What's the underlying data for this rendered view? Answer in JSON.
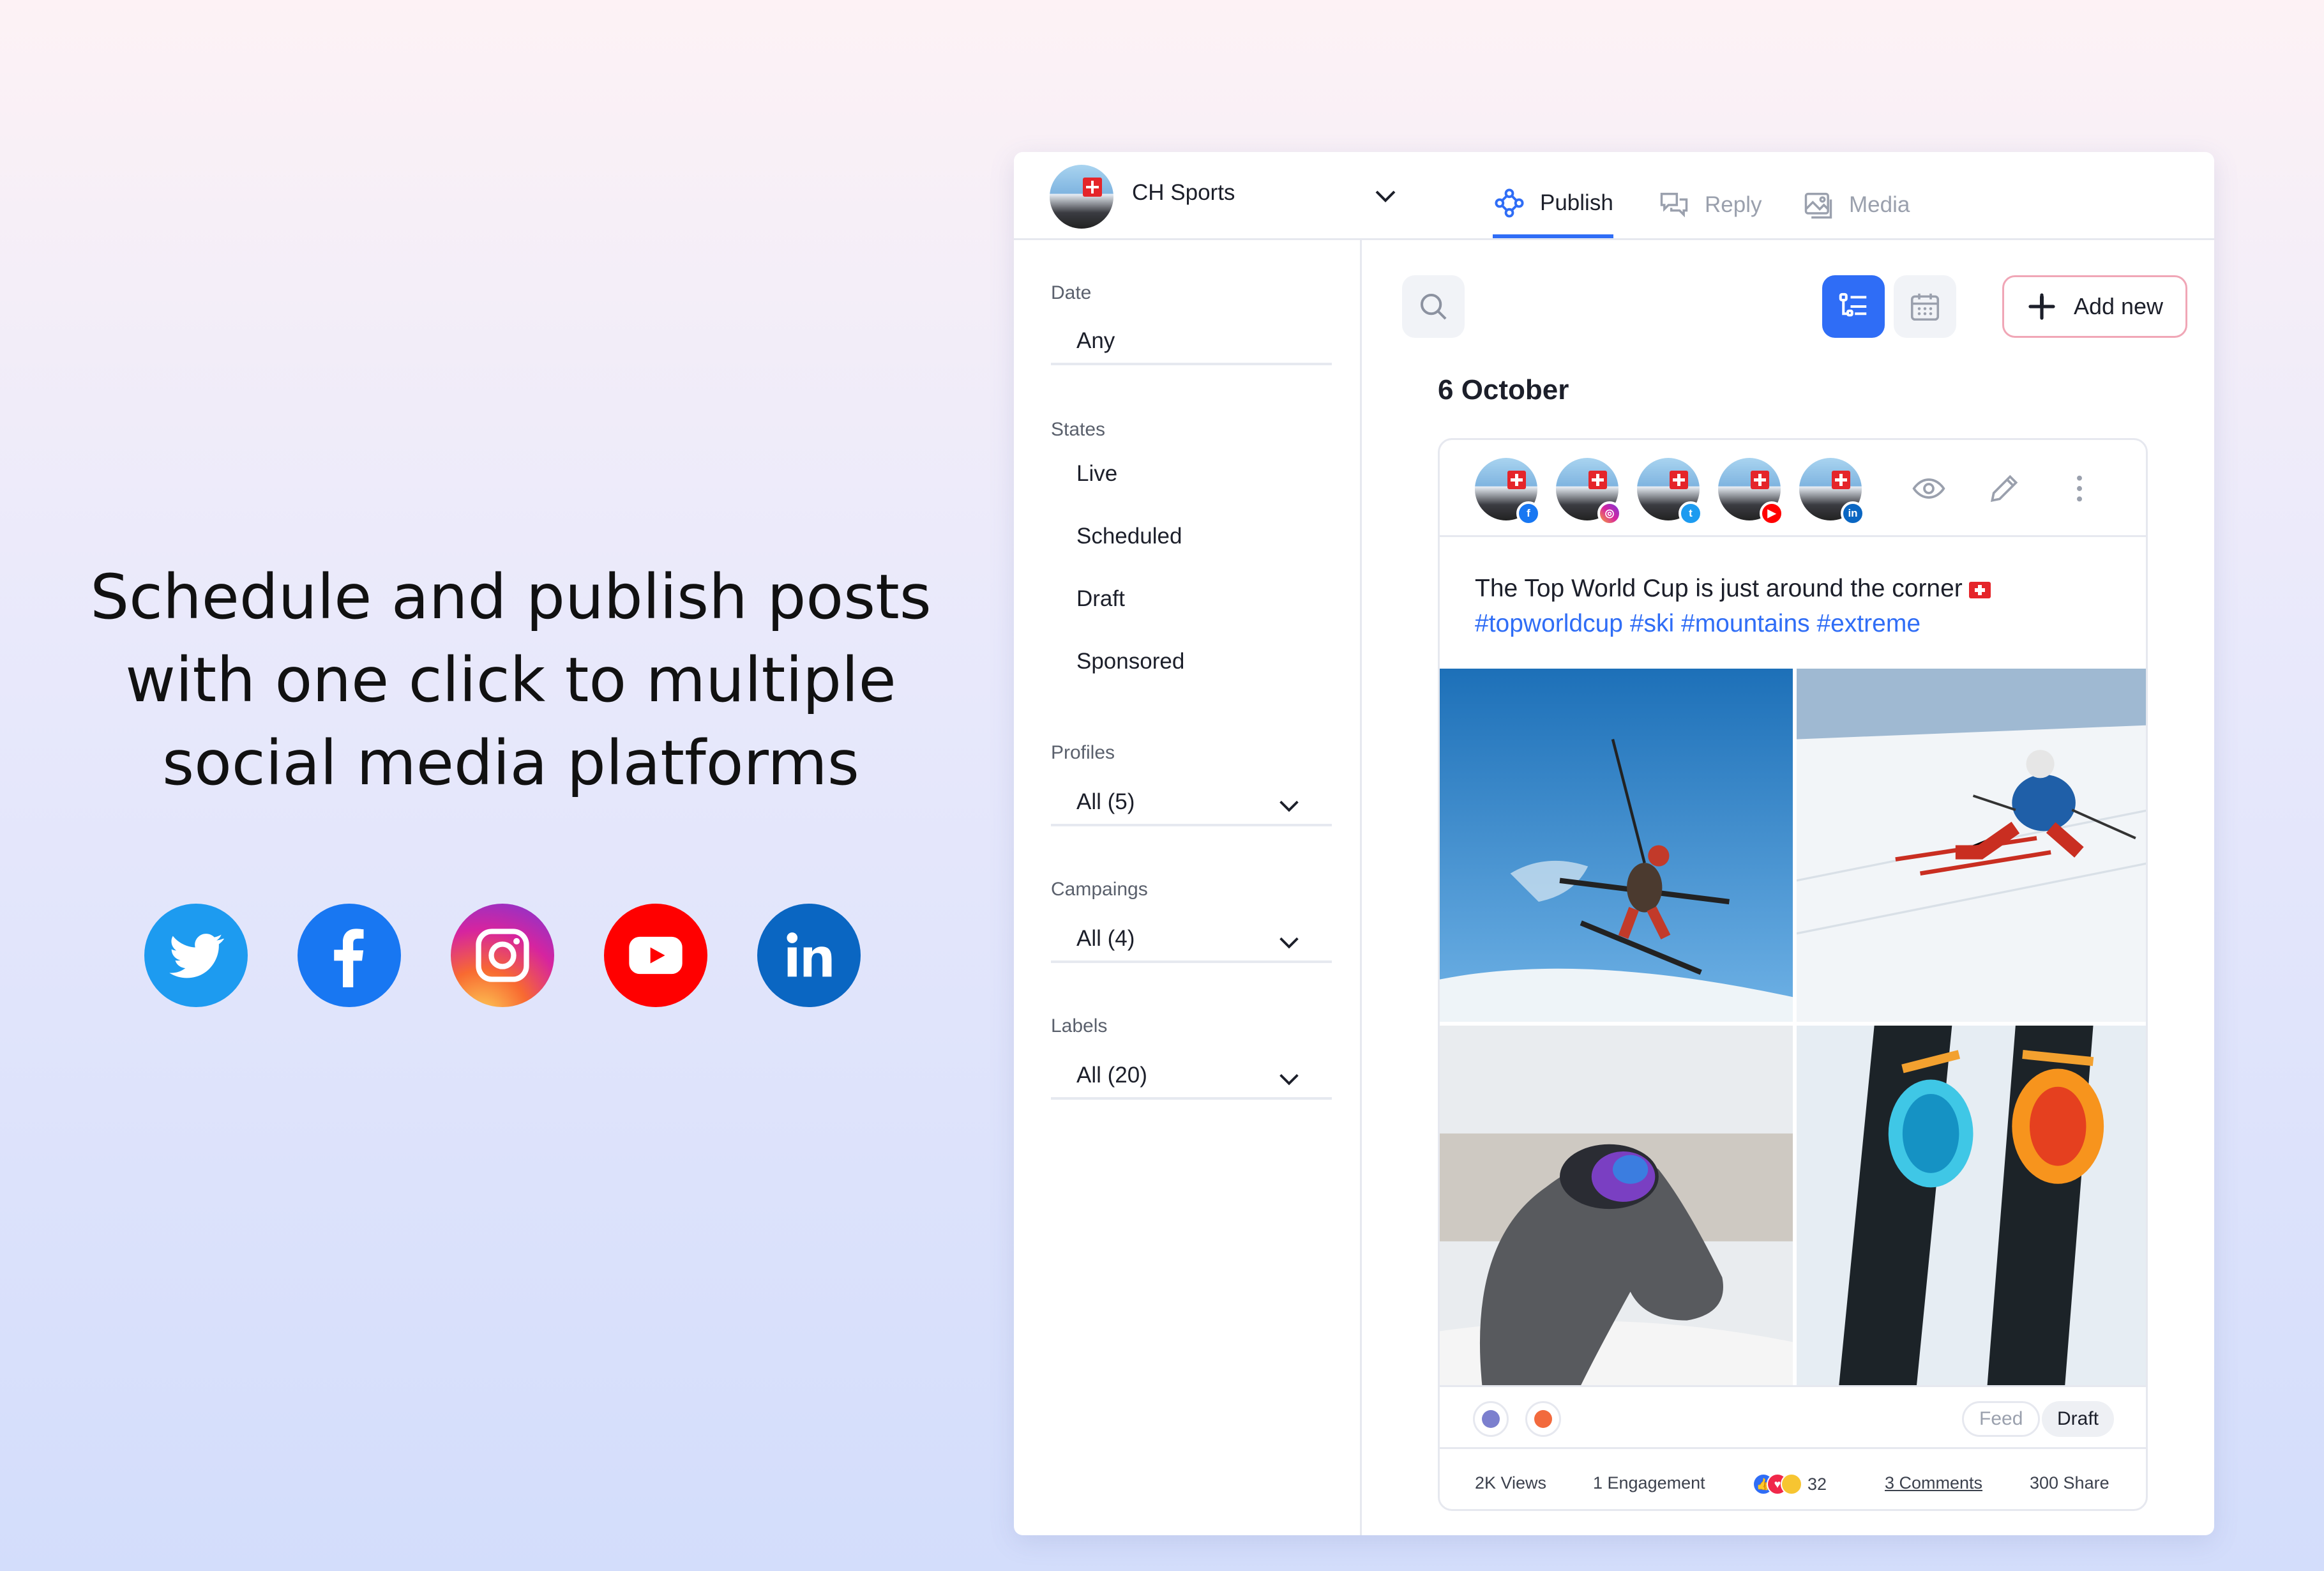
{
  "promo": {
    "headline_line1": "Schedule and publish posts",
    "headline_line2": "with one click to multiple",
    "headline_line3": "social media platforms",
    "social_icons": [
      "twitter-icon",
      "facebook-icon",
      "instagram-icon",
      "youtube-icon",
      "linkedin-icon"
    ]
  },
  "header": {
    "account_name": "CH Sports",
    "tabs": [
      {
        "label": "Publish",
        "icon": "publish-icon",
        "active": true
      },
      {
        "label": "Reply",
        "icon": "reply-icon",
        "active": false
      },
      {
        "label": "Media",
        "icon": "media-icon",
        "active": false
      }
    ]
  },
  "filters": {
    "date_label": "Date",
    "date_value": "Any",
    "states_label": "States",
    "states": [
      "Live",
      "Scheduled",
      "Draft",
      "Sponsored"
    ],
    "profiles_label": "Profiles",
    "profiles_value": "All (5)",
    "campaigns_label": "Campaings",
    "campaigns_value": "All (4)",
    "labels_label": "Labels",
    "labels_value": "All (20)"
  },
  "toolbar": {
    "add_new_label": "Add new"
  },
  "feed": {
    "date_heading": "6 October",
    "post": {
      "profiles": [
        "facebook",
        "instagram",
        "twitter",
        "youtube",
        "linkedin"
      ],
      "text": "The Top World Cup is just around the corner",
      "hashtags": "#topworldcup #ski #mountains #extreme",
      "images": [
        "ski-jump-photo",
        "skier-slope-photo",
        "dog-goggles-photo",
        "ski-goggles-photo"
      ],
      "label_dots": [
        "#7b7fce",
        "#f26a3d"
      ],
      "chips": [
        "Feed",
        "Draft"
      ],
      "stats": {
        "views": "2K Views",
        "engagement": "1 Engagement",
        "reactions": "32",
        "comments": "3 Comments",
        "shares": "300 Share"
      }
    }
  },
  "colors": {
    "accent": "#2f6df6",
    "twitter": "#1d9bf0",
    "facebook": "#1877f2",
    "youtube": "#ff0000",
    "linkedin": "#0a66c2"
  }
}
